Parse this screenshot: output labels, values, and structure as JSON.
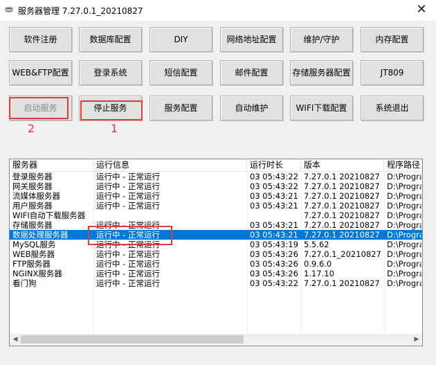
{
  "window": {
    "title": "服务器管理 7.27.0.1_20210827",
    "close_glyph": "✕"
  },
  "buttons_row1": [
    "软件注册",
    "数据库配置",
    "DIY",
    "网络地址配置",
    "维护/守护",
    "内存配置"
  ],
  "buttons_row2": [
    "WEB&FTP配置",
    "登录系统",
    "短信配置",
    "邮件配置",
    "存储服务器配置",
    "JT809"
  ],
  "buttons_row3": [
    "启动服务",
    "停止服务",
    "服务配置",
    "自动维护",
    "WIFI下载配置",
    "系统退出"
  ],
  "annotations": {
    "label1": "1",
    "label2": "2",
    "color": "#e23b3b"
  },
  "table": {
    "columns": [
      "服务器",
      "运行信息",
      "运行时长",
      "版本",
      "程序路径"
    ],
    "rows": [
      [
        "登录服务器",
        "运行中 - 正常运行",
        "03 05:43:22",
        "7.27.0.1 20210827",
        "D:\\Program"
      ],
      [
        "网关服务器",
        "运行中 - 正常运行",
        "03 05:43:22",
        "7.27.0.1 20210827",
        "D:\\Program"
      ],
      [
        "流媒体服务器",
        "运行中 - 正常运行",
        "03 05:43:21",
        "7.27.0.1 20210827",
        "D:\\Program"
      ],
      [
        "用户服务器",
        "运行中 - 正常运行",
        "03 05:43:21",
        "7.27.0.1 20210827",
        "D:\\Program"
      ],
      [
        "WIFI自动下载服务器",
        "",
        "",
        "7.27.0.1 20210827",
        "D:\\Program"
      ],
      [
        "存储服务器",
        "运行中 - 正常运行",
        "03 05:43:21",
        "7.27.0.1 20210827",
        "D:\\Program"
      ],
      [
        "数据处理服务器",
        "运行中 - 正常运行",
        "03 05:43:21",
        "7.27.0.1 20210827",
        "D:\\Program"
      ],
      [
        "MySQL服务",
        "运行中 - 正常运行",
        "03 05:43:19",
        "5.5.62",
        "D:\\Program"
      ],
      [
        "WEB服务器",
        "运行中 - 正常运行",
        "03 05:43:26",
        "7.27.0.1_20210827",
        "D:\\Program"
      ],
      [
        "FTP服务器",
        "运行中 - 正常运行",
        "03 05:43:26",
        "0.9.6.0",
        "D:\\Program"
      ],
      [
        "NGINX服务器",
        "运行中 - 正常运行",
        "03 05:43:26",
        "1.17.10",
        "D:\\Program"
      ],
      [
        "看门狗",
        "运行中 - 正常运行",
        "03 05:43:22",
        "7.27.0.1 20210827",
        "D:\\Program"
      ]
    ],
    "selected_row_index": 6
  },
  "colors": {
    "selection": "#0078d7",
    "highlight_box": "#e23b3b"
  }
}
